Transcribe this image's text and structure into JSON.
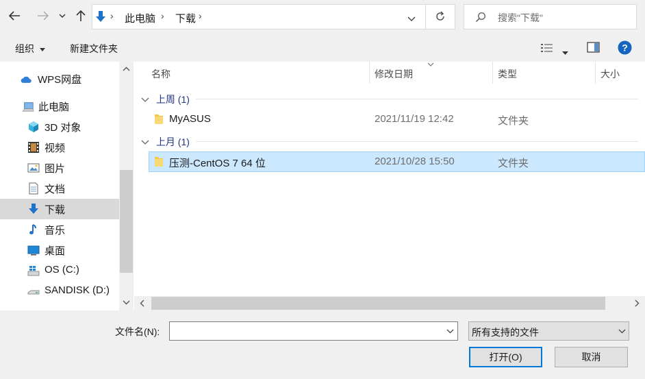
{
  "nav": {
    "back_icon": "arrow-left-icon",
    "forward_icon": "arrow-right-icon",
    "recent_icon": "chevron-down-icon",
    "up_icon": "arrow-up-icon"
  },
  "address": {
    "location_icon": "download-arrow-icon",
    "crumbs": [
      "此电脑",
      "下载"
    ],
    "refresh_icon": "refresh-icon"
  },
  "search": {
    "placeholder": "搜索\"下载\"",
    "icon": "search-icon"
  },
  "toolbar": {
    "organize_label": "组织",
    "new_folder_label": "新建文件夹"
  },
  "sidebar": {
    "items": [
      {
        "label": "WPS网盘",
        "icon": "cloud-icon"
      },
      {
        "label": "此电脑",
        "icon": "computer-icon"
      },
      {
        "label": "3D 对象",
        "icon": "cube-3d-icon"
      },
      {
        "label": "视频",
        "icon": "film-icon"
      },
      {
        "label": "图片",
        "icon": "picture-icon"
      },
      {
        "label": "文档",
        "icon": "document-icon"
      },
      {
        "label": "下载",
        "icon": "download-arrow-icon",
        "selected": true
      },
      {
        "label": "音乐",
        "icon": "music-note-icon"
      },
      {
        "label": "桌面",
        "icon": "desktop-icon"
      },
      {
        "label": "OS (C:)",
        "icon": "windows-drive-icon"
      },
      {
        "label": "SANDISK (D:)",
        "icon": "usb-drive-icon"
      }
    ]
  },
  "columns": {
    "name": "名称",
    "modified": "修改日期",
    "type": "类型",
    "size": "大小"
  },
  "groups": [
    {
      "label": "上周 (1)",
      "rows": [
        {
          "name": "MyASUS",
          "modified": "2021/11/19 12:42",
          "type": "文件夹",
          "selected": false
        }
      ]
    },
    {
      "label": "上月 (1)",
      "rows": [
        {
          "name": "压测-CentOS 7 64 位",
          "modified": "2021/10/28 15:50",
          "type": "文件夹",
          "selected": true
        }
      ]
    }
  ],
  "footer": {
    "filename_label": "文件名(N):",
    "filename_value": "",
    "filetype_value": "所有支持的文件",
    "open_label": "打开(O)",
    "cancel_label": "取消"
  },
  "colors": {
    "accent": "#0078d7",
    "selected_row_bg": "#cce8ff",
    "selected_row_border": "#99d1ff",
    "group_header": "#1e3287"
  }
}
